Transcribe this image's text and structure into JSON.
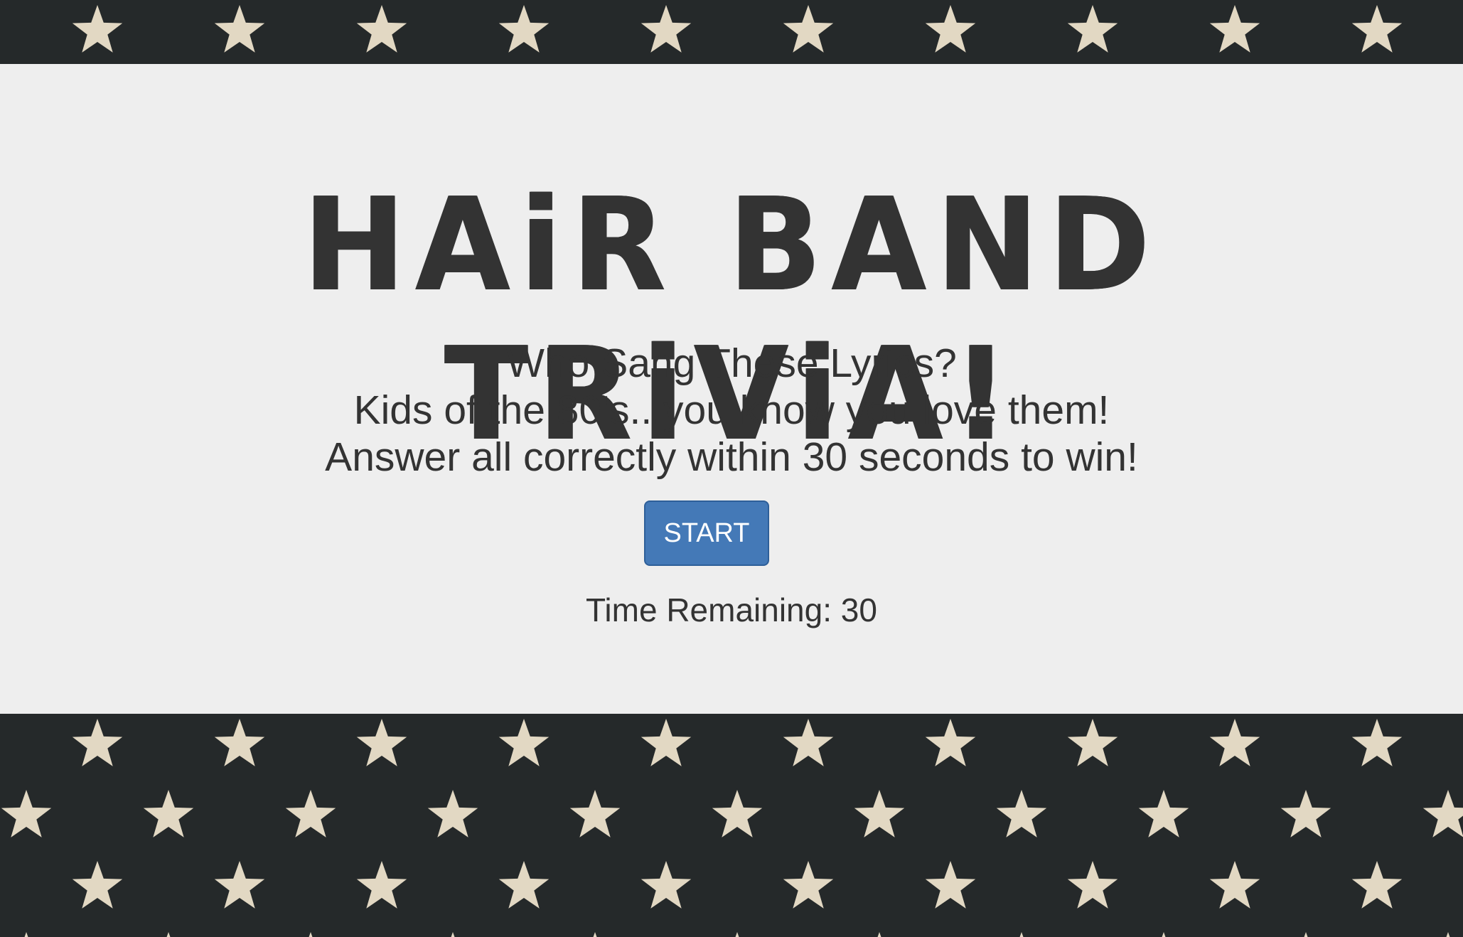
{
  "header": {
    "pattern_icon": "star-icon",
    "background_color": "#25292a",
    "star_color": "#e2d8c3"
  },
  "main": {
    "title": "HAiR BAND TRiViA!",
    "lyrics_heading": "Who Sang These Lyrics?",
    "tagline": "Kids of the 80's...you know you love them!",
    "instructions": "Answer all correctly within 30 seconds to win!",
    "start_label": "START",
    "timer_label": "Time Remaining: 30",
    "panel_color": "#eeeeee",
    "button_color": "#4479b7",
    "text_color": "#333333"
  },
  "footer": {
    "pattern_icon": "star-icon"
  }
}
